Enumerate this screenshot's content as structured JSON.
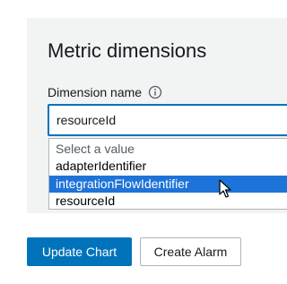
{
  "metric_dimensions": {
    "title": "Metric dimensions",
    "dimension_label": "Dimension name",
    "info_icon": "info-icon",
    "selected_value": "resourceId"
  },
  "dropdown": {
    "placeholder": "Select a value",
    "options": [
      {
        "label": "adapterIdentifier",
        "highlighted": false
      },
      {
        "label": "integrationFlowIdentifier",
        "highlighted": true
      },
      {
        "label": "resourceId",
        "highlighted": false
      }
    ]
  },
  "actions": {
    "update_chart_label": "Update Chart",
    "create_alarm_label": "Create Alarm"
  },
  "colors": {
    "accent": "#0073bb",
    "highlight": "#1e73d8",
    "panel_bg": "#f2f3f3"
  }
}
